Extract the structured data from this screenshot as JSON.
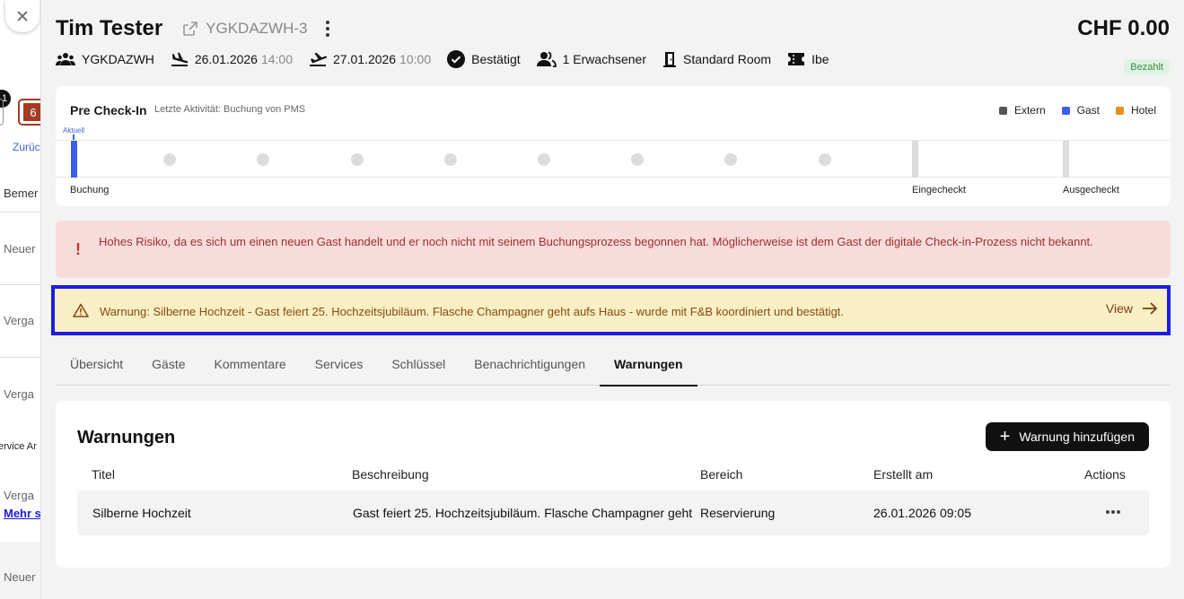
{
  "background": {
    "badge": "1",
    "tag": "6",
    "back_link": "Zurüc",
    "items": [
      "Bemer",
      "Neuer",
      "Verga",
      "Verga",
      "ervice Ar",
      "Verga",
      "Neuer"
    ],
    "more_link": "Mehr s"
  },
  "header": {
    "guest_name": "Tim Tester",
    "booking_code": "YGKDAZWH-3",
    "price": "CHF 0.00",
    "paid_badge": "Bezahlt",
    "meta": {
      "group": "YGKDAZWH",
      "arrival_date": "26.01.2026",
      "arrival_time": "14:00",
      "departure_date": "27.01.2026",
      "departure_time": "10:00",
      "status": "Bestätigt",
      "guests": "1 Erwachsener",
      "room": "Standard Room",
      "channel": "Ibe"
    }
  },
  "precheckin": {
    "title": "Pre Check-In",
    "activity": "Letzte Aktivität: Buchung von PMS",
    "current_label": "Aktuell",
    "legend": [
      {
        "label": "Extern",
        "color": "#555555"
      },
      {
        "label": "Gast",
        "color": "#3d5cf2"
      },
      {
        "label": "Hotel",
        "color": "#e3921e"
      }
    ],
    "labels": {
      "booking": "Buchung",
      "checked_in": "Eingecheckt",
      "checked_out": "Ausgecheckt"
    }
  },
  "alerts": {
    "risk": "Hohes Risiko, da es sich um einen neuen Gast handelt und er noch nicht mit seinem Buchungsprozess begonnen hat. Möglicherweise ist dem Gast der digitale Check-in-Prozess nicht bekannt.",
    "warning": "Warnung: Silberne Hochzeit - Gast feiert 25. Hochzeitsjubiläum. Flasche Champagner geht aufs Haus - wurde mit F&B koordiniert und bestätigt.",
    "view_label": "View"
  },
  "tabs": [
    "Übersicht",
    "Gäste",
    "Kommentare",
    "Services",
    "Schlüssel",
    "Benachrichtigungen",
    "Warnungen"
  ],
  "active_tab": "Warnungen",
  "warnings": {
    "title": "Warnungen",
    "add_label": "Warnung hinzufügen",
    "columns": [
      "Titel",
      "Beschreibung",
      "Bereich",
      "Erstellt am",
      "Actions"
    ],
    "rows": [
      {
        "title": "Silberne Hochzeit",
        "description": "Gast feiert 25. Hochzeitsjubiläum. Flasche Champagner geht",
        "area": "Reservierung",
        "created": "26.01.2026 09:05"
      }
    ]
  }
}
